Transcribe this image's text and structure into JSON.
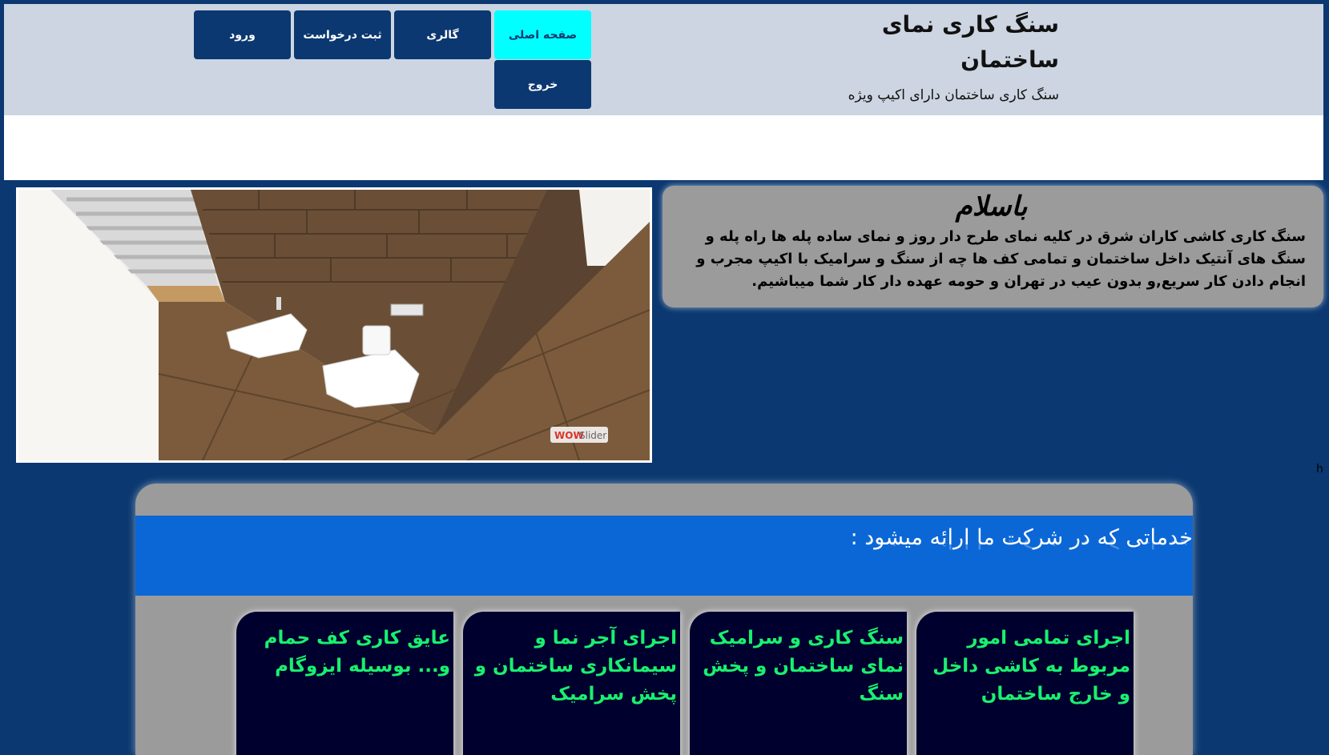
{
  "header": {
    "site_title": "سنگ کاری نمای ساختمان",
    "site_subtitle": "سنگ کاری ساختمان دارای اکیپ ویژه"
  },
  "nav": {
    "home": "صفحه اصلی",
    "gallery": "گالری",
    "register_request": "ثبت درخواست",
    "login": "ورود",
    "logout": "خروج",
    "active_item": "home",
    "active_color": "#00ffff",
    "button_color": "#0b3870"
  },
  "slider": {
    "watermark_wow": "WOW",
    "watermark_slider": "Slider"
  },
  "welcome": {
    "title": "باسلام",
    "body": "سنگ کاری کاشی کاران شرق در کلیه نمای طرح دار روز و نمای ساده پله ها راه پله و سنگ های آنتیک داخل ساختمان و تمامی کف ها چه از سنگ و سرامیک با اکیپ مجرب و انجام دادن کار سریع,و بدون عیب در تهران و حومه عهده دار کار شما میباشیم."
  },
  "stray_text": "h",
  "services": {
    "heading": "خدماتی که در شرکت ما ارائه میشود :",
    "items": [
      {
        "text": "اجرای تمامی امور مربوط به کاشی داخل و خارج ساختمان"
      },
      {
        "text": "سنگ کاری و سرامیک نمای ساختمان و پخش سنگ"
      },
      {
        "text": "اجرای آجر نما و سیمانکاری ساختمان و پخش سرامیک"
      },
      {
        "text": "عایق کاری کف حمام و... بوسیله ایزوگام"
      }
    ],
    "card_text_color": "#19f06f",
    "band_color": "#0b67d6"
  },
  "colors": {
    "page_background": "#0b3870",
    "header_background": "#ccd5e1",
    "panel_gray": "#9b9b9b",
    "card_background": "#00002f"
  }
}
